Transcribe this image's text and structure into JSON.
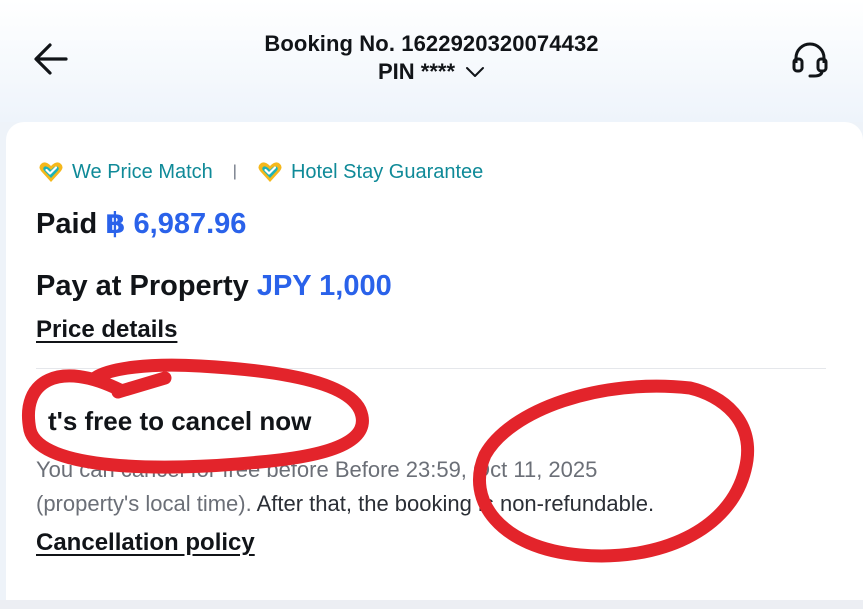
{
  "header": {
    "booking_number": "Booking No. 1622920320074432",
    "pin_label": "PIN ****",
    "back_icon": "arrow-left-icon",
    "support_icon": "headset-icon"
  },
  "badges": [
    {
      "label": "We Price Match",
      "icon": "heart-check-icon"
    },
    {
      "label": "Hotel Stay Guarantee",
      "icon": "heart-check-icon"
    }
  ],
  "payment": {
    "paid_label": "Paid",
    "paid_amount": "฿ 6,987.96",
    "pay_at_property_label": "Pay at Property",
    "pay_at_property_amount": "JPY 1,000",
    "price_details_link": "Price details"
  },
  "cancellation": {
    "title": "t's free to cancel now",
    "description_part1": "You can cancel for free before Before 23:59, Oct 11, 2025",
    "description_part2": "(property's local time).",
    "description_part3": " After that, the booking is non-refundable.",
    "policy_link": "Cancellation policy"
  },
  "colors": {
    "accent_blue": "#2a62ea",
    "badge_teal": "#0f8a98",
    "annotation_red": "#e3242b"
  }
}
